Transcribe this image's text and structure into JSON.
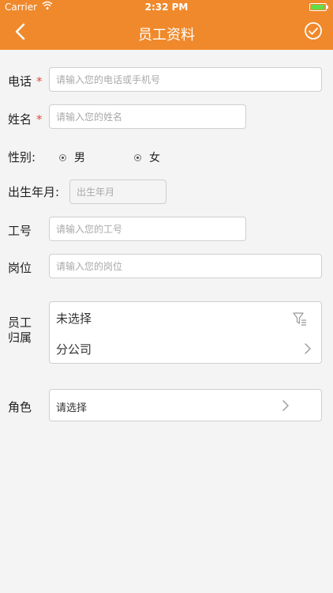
{
  "status_bar": {
    "carrier": "Carrier",
    "time": "2:32 PM"
  },
  "nav": {
    "title": "员工资料"
  },
  "form": {
    "phone": {
      "label": "电话",
      "required": "*",
      "placeholder": "请输入您的电话或手机号"
    },
    "name": {
      "label": "姓名",
      "required": "*",
      "placeholder": "请输入您的姓名"
    },
    "gender": {
      "label": "性别:",
      "option_male": "男",
      "option_female": "女"
    },
    "birth": {
      "label": "出生年月:",
      "placeholder": "出生年月"
    },
    "employee_id": {
      "label": "工号",
      "placeholder": "请输入您的工号"
    },
    "position": {
      "label": "岗位",
      "placeholder": "请输入您的岗位"
    },
    "affiliation": {
      "label_line1": "员工",
      "label_line2": "归属",
      "unselected": "未选择",
      "branch": "分公司"
    },
    "role": {
      "label": "角色",
      "value": "请选择"
    }
  }
}
